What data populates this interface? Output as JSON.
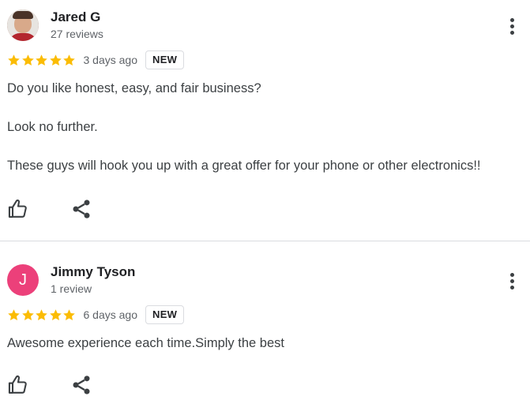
{
  "reviews": [
    {
      "author": "Jared G",
      "meta": "27 reviews",
      "avatar": {
        "type": "photo",
        "letter": ""
      },
      "rating": 5,
      "rating_max": 5,
      "date": "3 days ago",
      "badge": "NEW",
      "paragraphs": [
        "Do you like honest, easy, and fair business?",
        "Look no further.",
        "These guys will hook you up with a great offer for your phone or other electronics!!"
      ],
      "icons": {
        "like": "thumbs-up-icon",
        "share": "share-icon",
        "more": "more-vert-icon"
      }
    },
    {
      "author": "Jimmy Tyson",
      "meta": "1 review",
      "avatar": {
        "type": "letter",
        "letter": "J",
        "color": "#ec407a"
      },
      "rating": 5,
      "rating_max": 5,
      "date": "6 days ago",
      "badge": "NEW",
      "paragraphs": [
        "Awesome experience each time.Simply the best"
      ],
      "icons": {
        "like": "thumbs-up-icon",
        "share": "share-icon",
        "more": "more-vert-icon"
      }
    }
  ],
  "colors": {
    "star": "#fbbc04",
    "text_primary": "#202124",
    "text_secondary": "#5f6368",
    "divider": "#dadce0",
    "avatar_letter_bg": "#ec407a"
  }
}
